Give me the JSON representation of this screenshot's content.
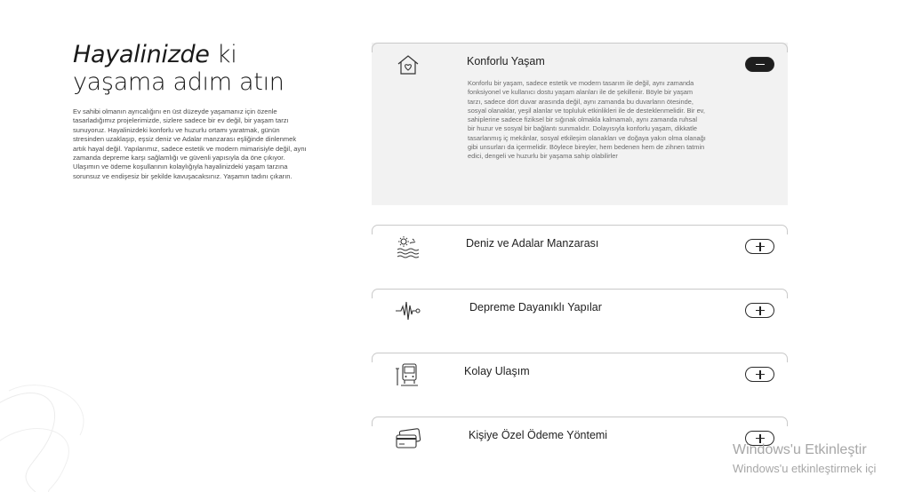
{
  "intro": {
    "title_italic": "Hayalinizde",
    "title_rest_line1": " ki",
    "title_line2": "yaşama adım atın",
    "description": "Ev sahibi olmanın ayrıcalığını en üst düzeyde yaşamanız için özenle tasarladığımız projelerimizde, sizlere sadece bir ev değil, bir yaşam tarzı sunuyoruz. Hayalinizdeki konforlu ve huzurlu ortamı yaratmak, günün stresinden uzaklaşıp, eşsiz deniz ve Adalar manzarası eşliğinde dinlenmek artık hayal değil. Yapılarımız, sadece estetik ve modern mimarisiyle değil, aynı zamanda depreme karşı sağlamlığı ve güvenli yapısıyla da öne çıkıyor. Ulaşımın ve ödeme koşullarının kolaylığıyla hayalinizdeki yaşam tarzına sorunsuz ve endişesiz bir şekilde kavuşacaksınız. Yaşamın tadını çıkarın."
  },
  "accordion": {
    "items": [
      {
        "title": "Konforlu Yaşam",
        "icon": "home-heart-icon",
        "expanded": true,
        "body": "Konforlu bir yaşam, sadece estetik ve modern tasarım ile değil, aynı zamanda fonksiyonel ve kullanıcı dostu yaşam alanları ile de şekillenir. Böyle bir yaşam tarzı, sadece dört duvar arasında değil, aynı zamanda bu duvarların ötesinde, sosyal olanaklar, yeşil alanlar ve topluluk etkinlikleri ile de desteklenmelidir. Bir ev, sahiplerine sadece fiziksel bir sığınak olmakla kalmamalı, aynı zamanda ruhsal bir huzur ve sosyal bir bağlantı sunmalıdır. Dolayısıyla konforlu yaşam, dikkatle tasarlanmış iç mekânlar, sosyal etkileşim olanakları ve doğaya yakın olma olanağı gibi unsurları da içermelidir. Böylece bireyler, hem bedenen hem de zihnen tatmin edici, dengeli ve huzurlu bir yaşama sahip olabilirler"
      },
      {
        "title": "Deniz ve Adalar Manzarası",
        "icon": "sea-view-icon",
        "expanded": false
      },
      {
        "title": "Depreme Dayanıklı Yapılar",
        "icon": "seismic-wave-icon",
        "expanded": false
      },
      {
        "title": "Kolay Ulaşım",
        "icon": "transport-icon",
        "expanded": false
      },
      {
        "title": "Kişiye Özel Ödeme Yöntemi",
        "icon": "credit-card-icon",
        "expanded": false
      }
    ]
  },
  "watermark": {
    "line1": "Windows'u Etkinleştir",
    "line2": "Windows'u etkinleştirmek içi"
  }
}
